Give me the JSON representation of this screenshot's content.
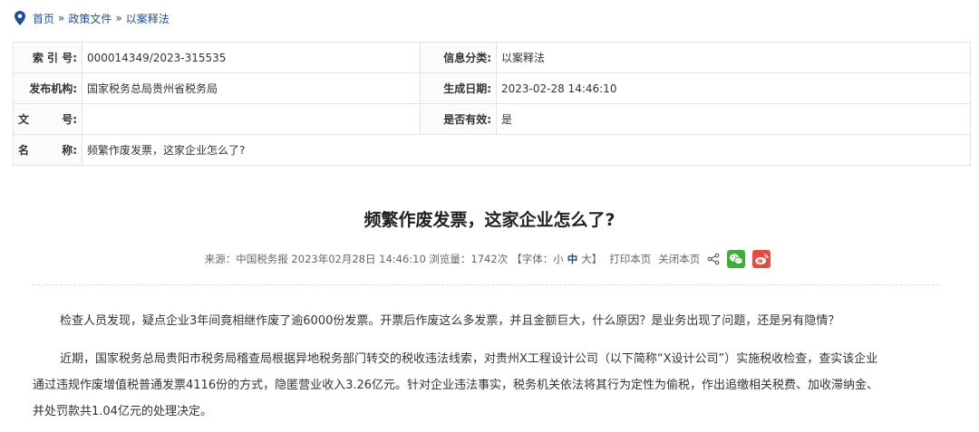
{
  "breadcrumb": {
    "items": [
      "首页",
      "政策文件",
      "以案释法"
    ],
    "separator": "»"
  },
  "meta": {
    "rows": [
      {
        "k1": "索 引 号:",
        "v1": "000014349/2023-315535",
        "k2": "信息分类:",
        "v2": "以案释法"
      },
      {
        "k1": "发布机构:",
        "v1": "国家税务总局贵州省税务局",
        "k2": "生成日期:",
        "v2": "2023-02-28 14:46:10"
      },
      {
        "k1a": "文",
        "k1b": "号:",
        "v1": "",
        "k2": "是否有效:",
        "v2": "是"
      }
    ],
    "name_row": {
      "ka": "名",
      "kb": "称:",
      "v": "频繁作废发票，这家企业怎么了?"
    }
  },
  "article": {
    "title": "频繁作废发票，这家企业怎么了?",
    "info": {
      "source": "来源：中国税务报 2023年02月28日 14:46:10 浏览量：1742次",
      "font_open": "【字体：",
      "small": "小",
      "medium": "中",
      "large": "大",
      "font_close": "】",
      "print": "打印本页",
      "close": "关闭本页"
    },
    "p1": "检查人员发现，疑点企业3年间竟相继作废了逾6000份发票。开票后作废这么多发票，并且金额巨大，什么原因？是业务出现了问题，还是另有隐情？",
    "p2_line1": "近期，国家税务总局贵阳市税务局稽查局根据异地税务部门转交的税收违法线索，对贵州X工程设计公司（以下简称“X设计公司”）实施税收检查，查实该企业",
    "p2_line2": "通过违规作废增值税普通发票4116份的方式，隐匿营业收入3.26亿元。针对企业违法事实，税务机关依法将其行为定性为偷税，作出追缴相关税费、加收滞纳金、",
    "p2_line3": "并处罚款共1.04亿元的处理决定。"
  },
  "colors": {
    "link": "#1d4d9a",
    "wechat": "#3cb034",
    "weibo": "#e84a3f"
  }
}
